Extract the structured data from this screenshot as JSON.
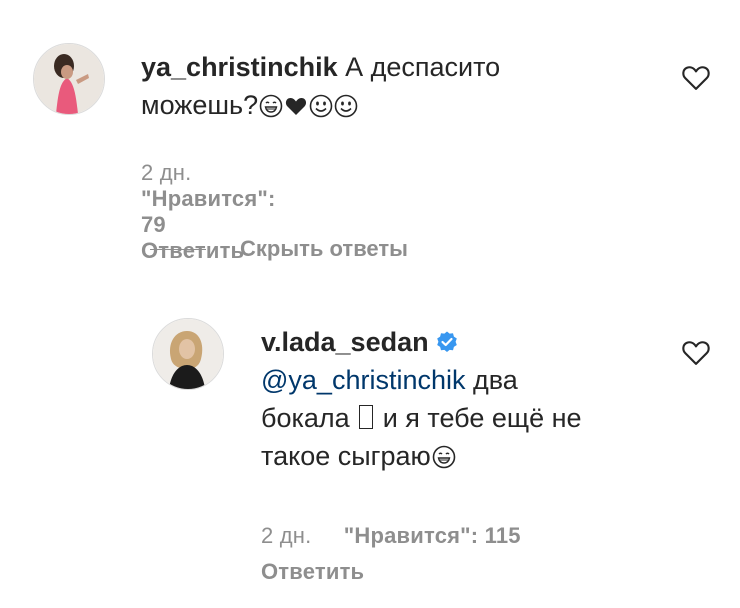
{
  "comment1": {
    "username": "ya_christinchik",
    "text_line1": "А деспасито",
    "text_line2": "можешь?",
    "emojis": [
      "grinning-face-emoji",
      "black-heart-emoji",
      "smiling-face-emoji",
      "smiling-face-emoji"
    ],
    "time": "2 дн.",
    "likes": "\"Нравится\": 79",
    "reply": "Ответить"
  },
  "hide_replies_label": "Скрыть ответы",
  "reply1": {
    "username": "v.lada_sedan",
    "mention": "@ya_christinchik",
    "text_after_mention": " два",
    "text_line2_a": "бокала ",
    "text_line2_b": " и я тебе ещё не",
    "text_line3": "такое сыграю",
    "emojis": [
      "grinning-face-emoji"
    ],
    "time": "2 дн.",
    "likes": "\"Нравится\": 115",
    "reply": "Ответить"
  },
  "colors": {
    "text": "#262626",
    "secondary": "#8e8e8e",
    "mention": "#00376b",
    "verified": "#3897f0"
  },
  "icons": [
    "heart-outline-icon",
    "verified-badge-icon"
  ]
}
